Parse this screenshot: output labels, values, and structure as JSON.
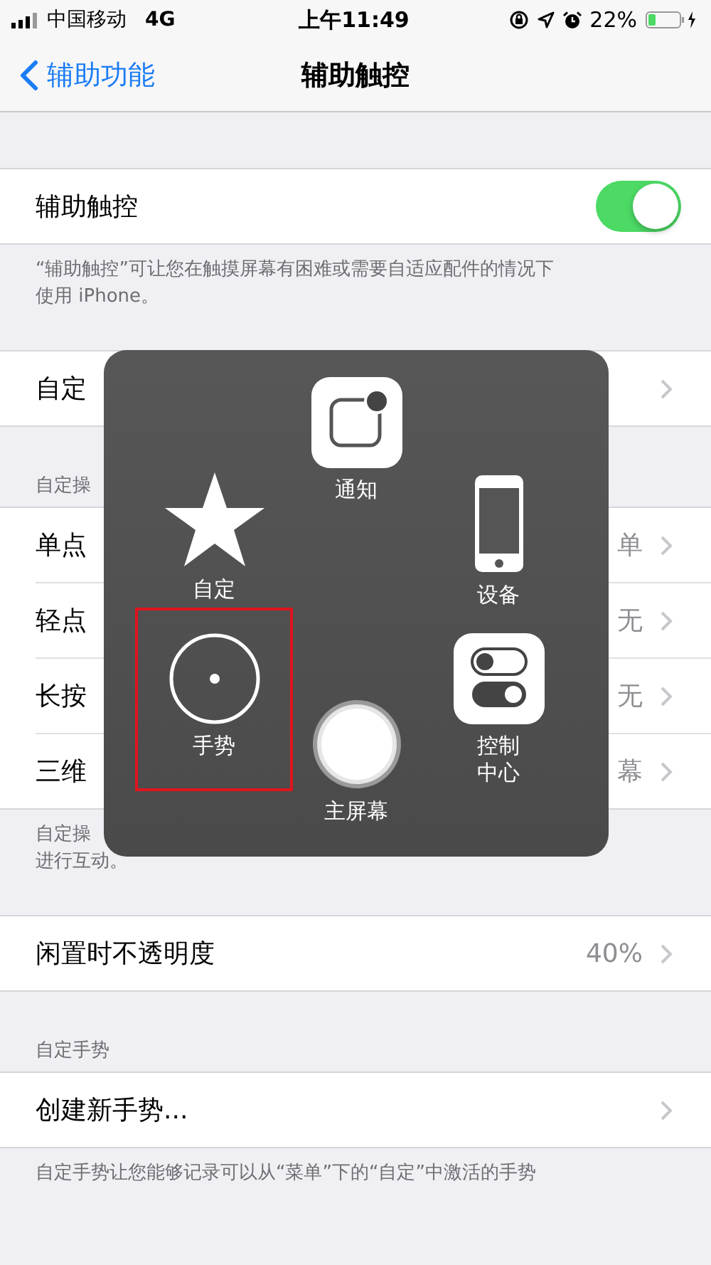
{
  "status_bar": {
    "carrier": "中国移动",
    "network": "4G",
    "time": "上午11:49",
    "battery": "22%"
  },
  "nav": {
    "back": "辅助功能",
    "title": "辅助触控"
  },
  "groups": [
    {
      "rows": [
        {
          "kind": "toggle",
          "label": "辅助触控",
          "on": true
        }
      ],
      "footer": [
        "“辅助触控”可让您在触摸屏幕有困难或需要自适应配件的情况下",
        "使用 iPhone。"
      ]
    },
    {
      "rows": [
        {
          "kind": "link",
          "label": "自定"
        }
      ]
    },
    {
      "header": "自定操",
      "rows": [
        {
          "kind": "link",
          "label": "单点",
          "value": "单"
        },
        {
          "kind": "link",
          "label": "轻点",
          "value": "无"
        },
        {
          "kind": "link",
          "label": "长按",
          "value": "无"
        },
        {
          "kind": "link",
          "label": "三维",
          "value": "幕"
        }
      ],
      "footer": [
        "自定操",
        "进行互动。"
      ]
    },
    {
      "rows": [
        {
          "kind": "link",
          "label": "闲置时不透明度",
          "value": "40%"
        }
      ]
    },
    {
      "header": "自定手势",
      "rows": [
        {
          "kind": "link",
          "label": "创建新手势..."
        }
      ],
      "footer": [
        "自定手势让您能够记录可以从“菜单”下的“自定”中激活的手势"
      ]
    }
  ],
  "menu": {
    "items": [
      {
        "kind": "notification",
        "label": "通知",
        "highlighted": false
      },
      {
        "kind": "custom",
        "label": "自定",
        "highlighted": false
      },
      {
        "kind": "device",
        "label": "设备",
        "highlighted": false
      },
      {
        "kind": "gesture",
        "label": "手势",
        "highlighted": true
      },
      {
        "kind": "home",
        "label": "主屏幕",
        "highlighted": false
      },
      {
        "kind": "control",
        "label": "控制中心",
        "highlighted": false
      }
    ]
  }
}
